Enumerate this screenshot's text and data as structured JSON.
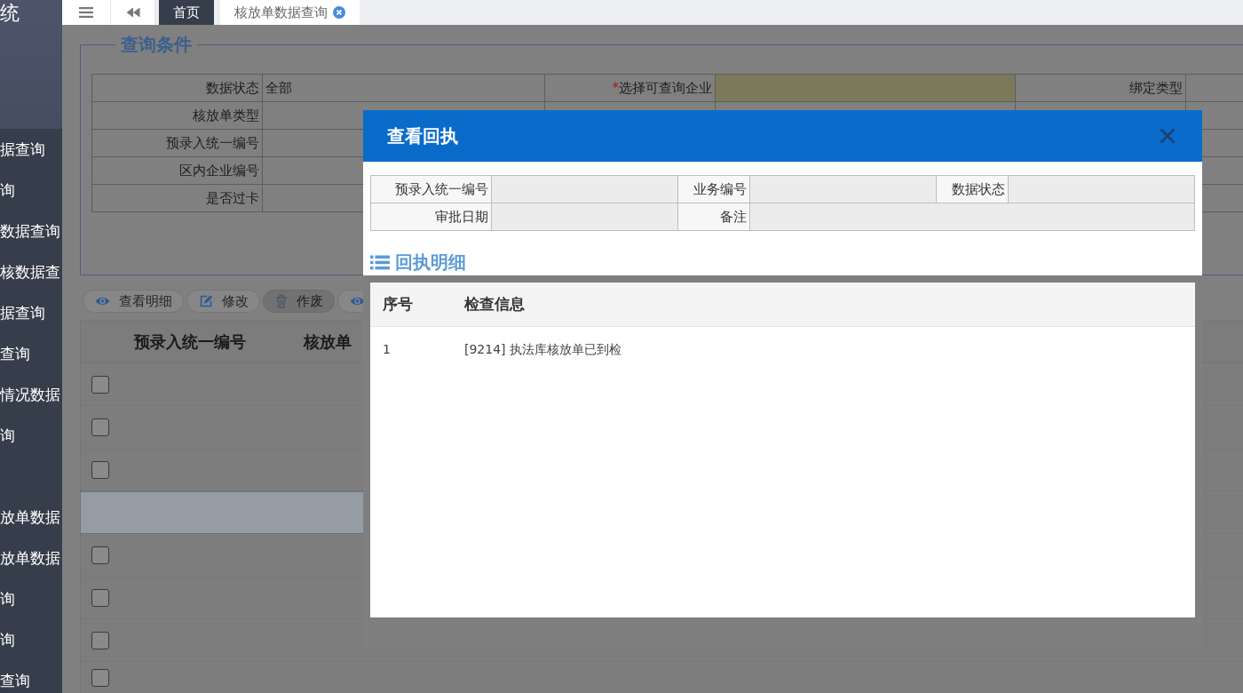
{
  "sidebar": {
    "title": "统",
    "groups": [
      {
        "items": [
          "据查询",
          "询",
          "数据查询",
          "核数据查",
          "据查询",
          "查询",
          "情况数据",
          "询"
        ]
      },
      {
        "items": [
          "放单数据",
          "放单数据",
          "询",
          "询",
          "查询"
        ]
      }
    ]
  },
  "tab_bar": {
    "tabs": [
      {
        "label": "首页",
        "selected": true,
        "closable": false
      },
      {
        "label": "核放单数据查询",
        "selected": false,
        "closable": true
      }
    ]
  },
  "query_panel": {
    "title": "查询条件",
    "rows": [
      {
        "fields": [
          {
            "label": "数据状态",
            "value": "全部",
            "highlighted": false
          },
          {
            "label": "选择可查询企业",
            "required_mark": "*",
            "highlighted": true
          },
          {
            "label": "绑定类型",
            "highlighted": false
          }
        ]
      },
      {
        "fields": [
          {
            "label": "核放单类型",
            "highlighted": false
          }
        ]
      },
      {
        "fields": [
          {
            "label": "预录入统一编号",
            "highlighted": false
          }
        ]
      },
      {
        "fields": [
          {
            "label": "区内企业编号",
            "highlighted": false
          }
        ]
      },
      {
        "fields": [
          {
            "label": "是否过卡",
            "highlighted": false
          }
        ]
      }
    ]
  },
  "toolbar": [
    {
      "kind": "view",
      "label": "查看明细",
      "disabled": false
    },
    {
      "kind": "edit",
      "label": "修改",
      "disabled": false
    },
    {
      "kind": "void",
      "label": "作废",
      "disabled": true
    },
    {
      "kind": "view",
      "disabled": false
    }
  ],
  "grid": {
    "columns": [
      "预录入统一编号",
      "核放单"
    ],
    "rows": [
      {
        "selected": false,
        "checked": false
      },
      {
        "selected": false,
        "checked": false
      },
      {
        "selected": false,
        "checked": false
      },
      {
        "selected": true
      },
      {
        "selected": false,
        "checked": false
      },
      {
        "selected": false,
        "checked": false
      },
      {
        "selected": false,
        "checked": false
      },
      {
        "selected": false,
        "checked": false
      }
    ]
  },
  "dialog": {
    "title": "查看回执",
    "info_rows": [
      {
        "fields": [
          {
            "label": "预录入统一编号"
          },
          {
            "label": "业务编号"
          },
          {
            "label": "数据状态"
          }
        ]
      },
      {
        "fields": [
          {
            "label": "审批日期"
          },
          {
            "label": "备注"
          }
        ]
      }
    ],
    "section_title": "回执明细",
    "detail_table": {
      "columns": [
        "序号",
        "检查信息"
      ],
      "rows": [
        [
          "1",
          "[9214] 执法库核放单已到检"
        ]
      ]
    }
  }
}
